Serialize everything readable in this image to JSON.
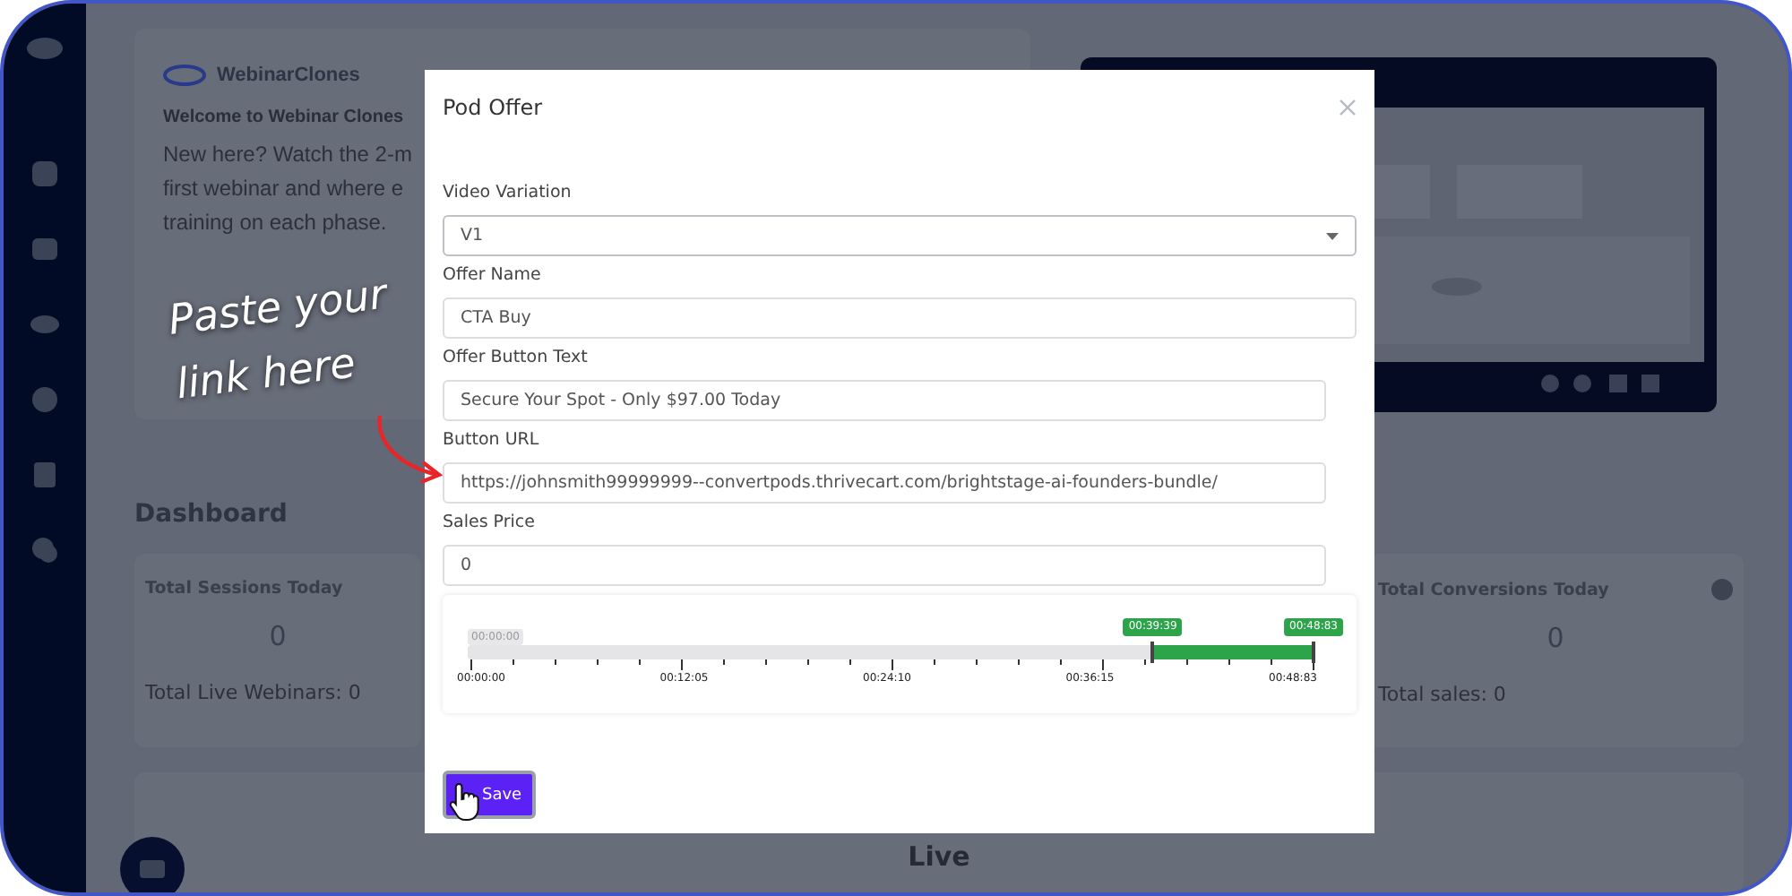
{
  "welcome_card": {
    "brand": "WebinarClones",
    "title": "Welcome to Webinar Clones",
    "body_lines": [
      "New here? Watch the 2-m",
      "first webinar and where e",
      "training on each phase."
    ]
  },
  "dashboard": {
    "title": "Dashboard",
    "cards": [
      {
        "label": "Total Sessions Today",
        "value": "0",
        "footer": "Total Live Webinars: 0",
        "info": false
      },
      {
        "label": "Total Conversions Today",
        "value": "0",
        "footer": "Total sales: 0",
        "info": true
      }
    ]
  },
  "live": {
    "title": "Live"
  },
  "modal": {
    "title": "Pod Offer",
    "fields": [
      {
        "kind": "select",
        "label": "Video Variation",
        "value": "V1",
        "wide": true
      },
      {
        "kind": "text",
        "label": "Offer Name",
        "value": "CTA Buy",
        "wide": true
      },
      {
        "kind": "text",
        "label": "Offer Button Text",
        "value": "Secure Your Spot - Only $97.00 Today",
        "wide": false
      },
      {
        "kind": "text",
        "label": "Button URL",
        "value": "https://johnsmith99999999--convertpods.thrivecart.com/brightstage-ai-founders-bundle/",
        "wide": false
      },
      {
        "kind": "text",
        "label": "Sales Price",
        "value": "0",
        "wide": false
      }
    ],
    "timeline": {
      "start_label": "00:00:00",
      "handles": [
        "00:39:39",
        "00:48:83"
      ],
      "level": 0.19,
      "ticks": [
        "00:00:00",
        "00:12:05",
        "00:24:10",
        "00:36:15",
        "00:48:83"
      ]
    },
    "save_button": "Save"
  },
  "annotation": {
    "lines": [
      "Paste your",
      "link here"
    ]
  }
}
